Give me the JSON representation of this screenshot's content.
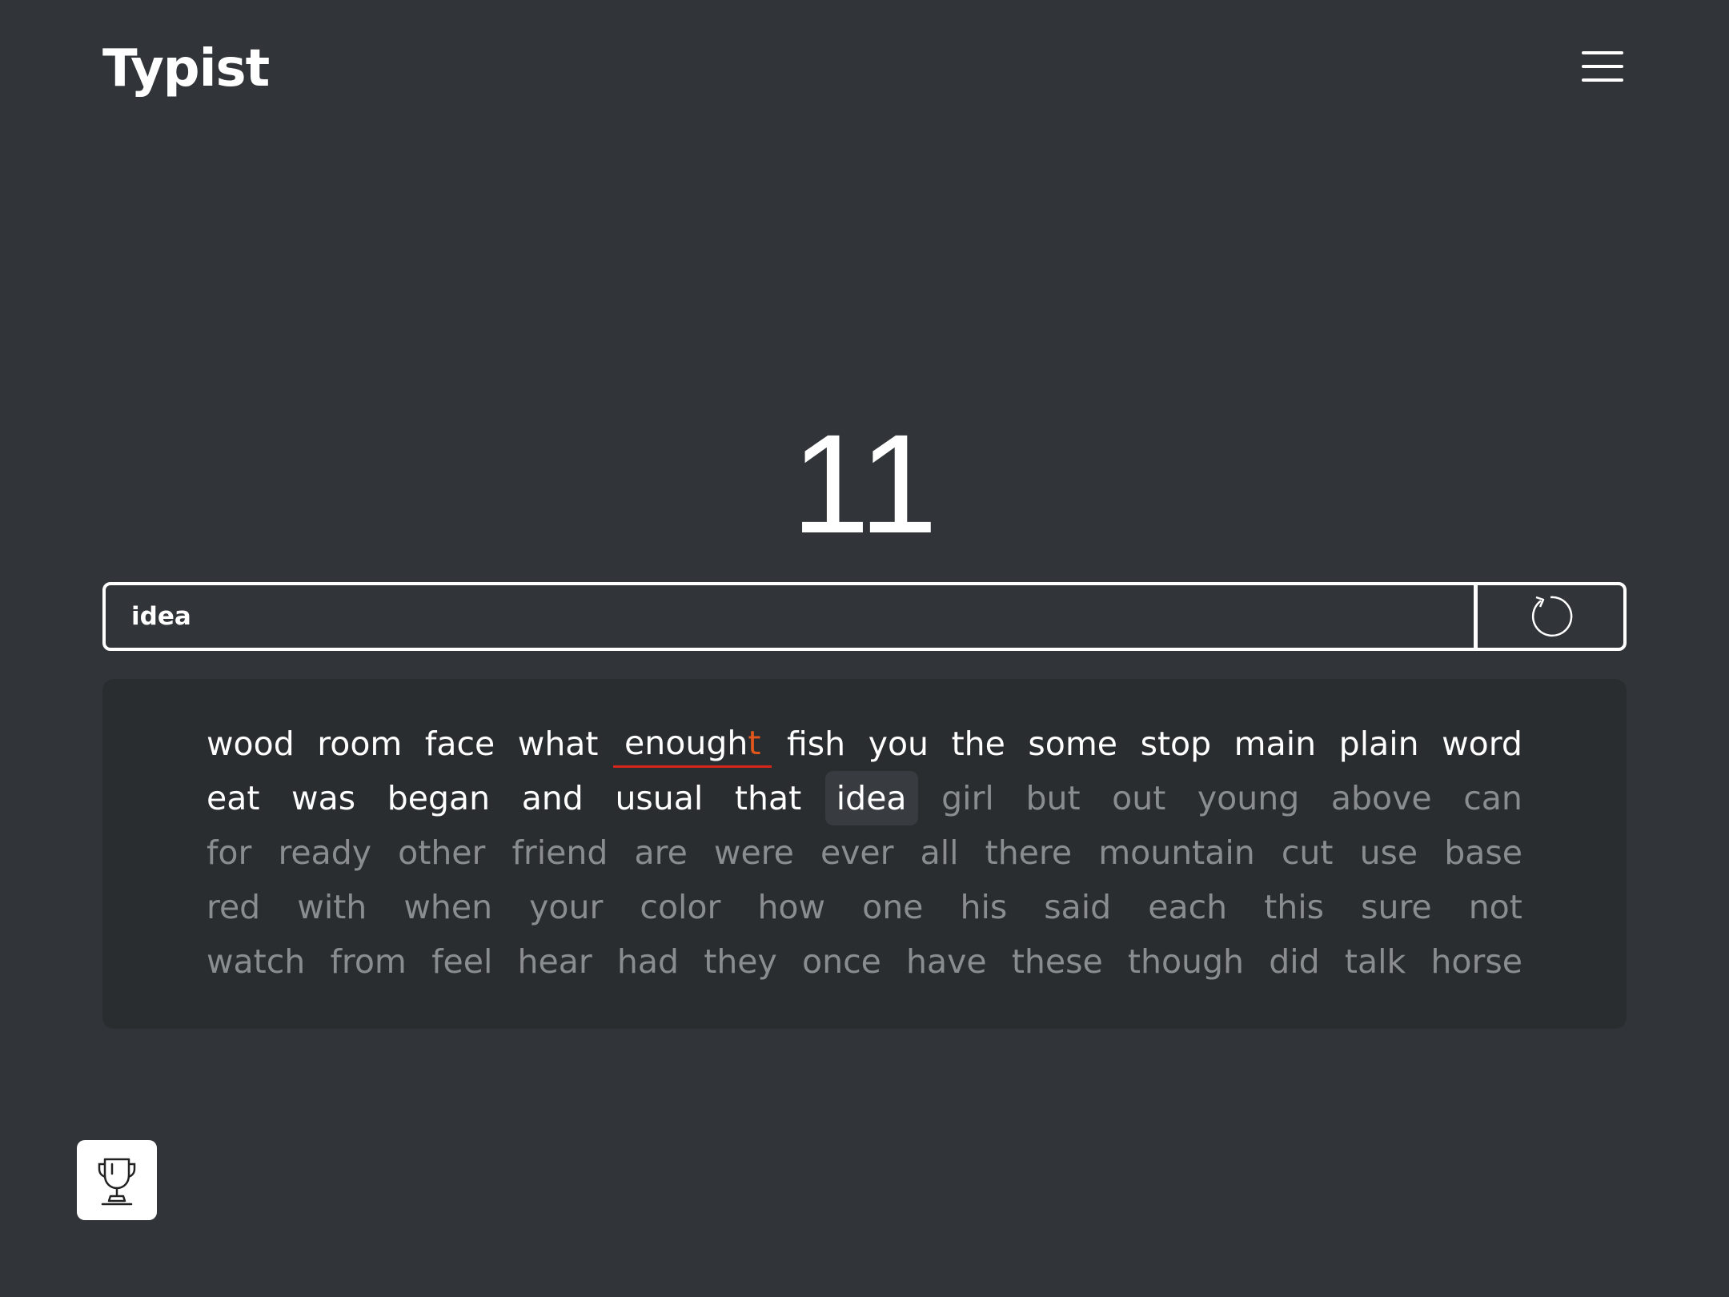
{
  "header": {
    "logo": "Typist",
    "menu_icon": "hamburger-menu-icon"
  },
  "timer": {
    "seconds": "11"
  },
  "typing": {
    "input_value": "idea",
    "restart_icon": "restart-icon"
  },
  "words": {
    "rows": [
      [
        {
          "text": "wood",
          "state": "done"
        },
        {
          "text": "room",
          "state": "done"
        },
        {
          "text": "face",
          "state": "done"
        },
        {
          "text": "what",
          "state": "done"
        },
        {
          "text": "enough",
          "extra": "t",
          "state": "error"
        },
        {
          "text": "fish",
          "state": "done"
        },
        {
          "text": "you",
          "state": "done"
        },
        {
          "text": "the",
          "state": "done"
        },
        {
          "text": "some",
          "state": "done"
        },
        {
          "text": "stop",
          "state": "done"
        },
        {
          "text": "main",
          "state": "done"
        },
        {
          "text": "plain",
          "state": "done"
        },
        {
          "text": "word",
          "state": "done"
        }
      ],
      [
        {
          "text": "eat",
          "state": "done"
        },
        {
          "text": "was",
          "state": "done"
        },
        {
          "text": "began",
          "state": "done"
        },
        {
          "text": "and",
          "state": "done"
        },
        {
          "text": "usual",
          "state": "done"
        },
        {
          "text": "that",
          "state": "done"
        },
        {
          "text": "idea",
          "state": "current"
        },
        {
          "text": "girl",
          "state": "pending"
        },
        {
          "text": "but",
          "state": "pending"
        },
        {
          "text": "out",
          "state": "pending"
        },
        {
          "text": "young",
          "state": "pending"
        },
        {
          "text": "above",
          "state": "pending"
        },
        {
          "text": "can",
          "state": "pending"
        }
      ],
      [
        {
          "text": "for",
          "state": "pending"
        },
        {
          "text": "ready",
          "state": "pending"
        },
        {
          "text": "other",
          "state": "pending"
        },
        {
          "text": "friend",
          "state": "pending"
        },
        {
          "text": "are",
          "state": "pending"
        },
        {
          "text": "were",
          "state": "pending"
        },
        {
          "text": "ever",
          "state": "pending"
        },
        {
          "text": "all",
          "state": "pending"
        },
        {
          "text": "there",
          "state": "pending"
        },
        {
          "text": "mountain",
          "state": "pending"
        },
        {
          "text": "cut",
          "state": "pending"
        },
        {
          "text": "use",
          "state": "pending"
        },
        {
          "text": "base",
          "state": "pending"
        }
      ],
      [
        {
          "text": "red",
          "state": "pending"
        },
        {
          "text": "with",
          "state": "pending"
        },
        {
          "text": "when",
          "state": "pending"
        },
        {
          "text": "your",
          "state": "pending"
        },
        {
          "text": "color",
          "state": "pending"
        },
        {
          "text": "how",
          "state": "pending"
        },
        {
          "text": "one",
          "state": "pending"
        },
        {
          "text": "his",
          "state": "pending"
        },
        {
          "text": "said",
          "state": "pending"
        },
        {
          "text": "each",
          "state": "pending"
        },
        {
          "text": "this",
          "state": "pending"
        },
        {
          "text": "sure",
          "state": "pending"
        },
        {
          "text": "not",
          "state": "pending"
        }
      ],
      [
        {
          "text": "watch",
          "state": "pending"
        },
        {
          "text": "from",
          "state": "pending"
        },
        {
          "text": "feel",
          "state": "pending"
        },
        {
          "text": "hear",
          "state": "pending"
        },
        {
          "text": "had",
          "state": "pending"
        },
        {
          "text": "they",
          "state": "pending"
        },
        {
          "text": "once",
          "state": "pending"
        },
        {
          "text": "have",
          "state": "pending"
        },
        {
          "text": "these",
          "state": "pending"
        },
        {
          "text": "though",
          "state": "pending"
        },
        {
          "text": "did",
          "state": "pending"
        },
        {
          "text": "talk",
          "state": "pending"
        },
        {
          "text": "horse",
          "state": "pending"
        }
      ]
    ]
  },
  "footer": {
    "trophy_icon": "trophy-icon"
  },
  "colors": {
    "background": "#313539",
    "panel": "#2a2d30",
    "text": "#ffffff",
    "pending_text": "#8a8d8f",
    "error_underline": "#d6261b",
    "extra_char": "#e0561b"
  }
}
